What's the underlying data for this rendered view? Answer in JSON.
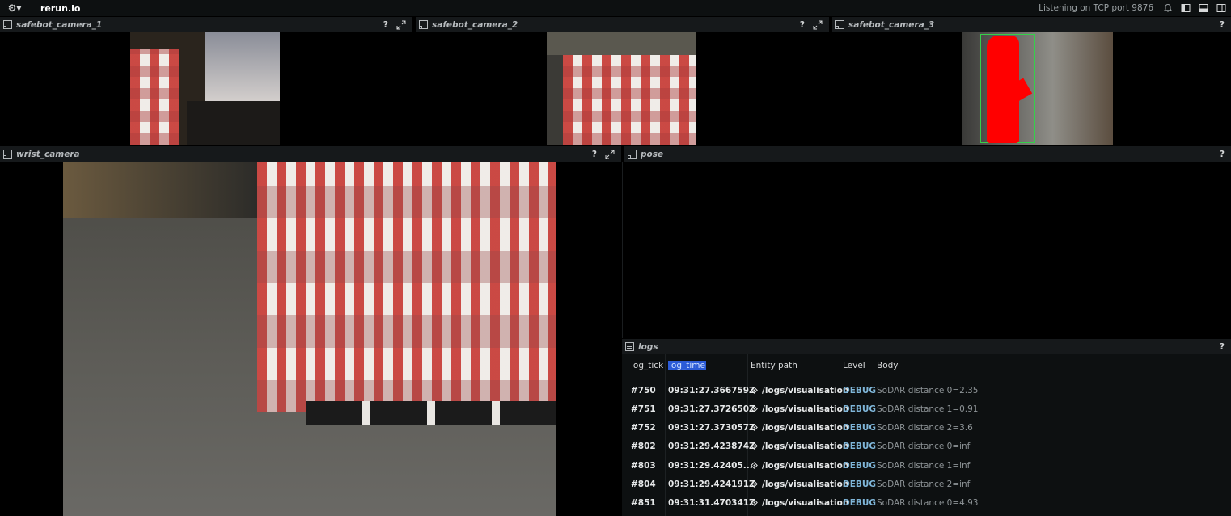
{
  "topbar": {
    "app_title": "rerun.io",
    "status": "Listening on TCP port 9876",
    "menu_icon": "rerun-logo-icon",
    "notification_icon": "bell-icon",
    "left_panel_icon": "left-panel-toggle-icon",
    "bottom_panel_icon": "bottom-panel-toggle-icon",
    "right_panel_icon": "right-panel-toggle-icon"
  },
  "panels": {
    "cam1": {
      "title": "safebot_camera_1",
      "help": "?"
    },
    "cam2": {
      "title": "safebot_camera_2",
      "help": "?"
    },
    "cam3": {
      "title": "safebot_camera_3",
      "help": "?"
    },
    "wrist": {
      "title": "wrist_camera",
      "help": "?"
    },
    "pose": {
      "title": "pose",
      "help": "?"
    },
    "logs": {
      "title": "logs",
      "help": "?"
    }
  },
  "logs": {
    "columns": [
      "log_tick",
      "log_time",
      "Entity path",
      "Level",
      "Body"
    ],
    "rows": [
      {
        "tick": "#750",
        "time": "09:31:27.366759Z",
        "path": "/logs/visualisation",
        "level": "DEBUG",
        "body": "SoDAR distance 0=2.35"
      },
      {
        "tick": "#751",
        "time": "09:31:27.372650Z",
        "path": "/logs/visualisation",
        "level": "DEBUG",
        "body": "SoDAR distance 1=0.91"
      },
      {
        "tick": "#752",
        "time": "09:31:27.373057Z",
        "path": "/logs/visualisation",
        "level": "DEBUG",
        "body": "SoDAR distance 2=3.6"
      },
      {
        "tick": "#802",
        "time": "09:31:29.423874Z",
        "path": "/logs/visualisation",
        "level": "DEBUG",
        "body": "SoDAR distance 0=inf"
      },
      {
        "tick": "#803",
        "time": "09:31:29.42405...",
        "path": "/logs/visualisation",
        "level": "DEBUG",
        "body": "SoDAR distance 1=inf"
      },
      {
        "tick": "#804",
        "time": "09:31:29.424191Z",
        "path": "/logs/visualisation",
        "level": "DEBUG",
        "body": "SoDAR distance 2=inf"
      },
      {
        "tick": "#851",
        "time": "09:31:31.470341Z",
        "path": "/logs/visualisation",
        "level": "DEBUG",
        "body": "SoDAR distance 0=4.93"
      }
    ]
  },
  "colors": {
    "accent_selection": "#2b5bd7",
    "debug_level": "#7fb6d9",
    "segmentation": "#ff0000",
    "bbox": "#35d04a"
  }
}
